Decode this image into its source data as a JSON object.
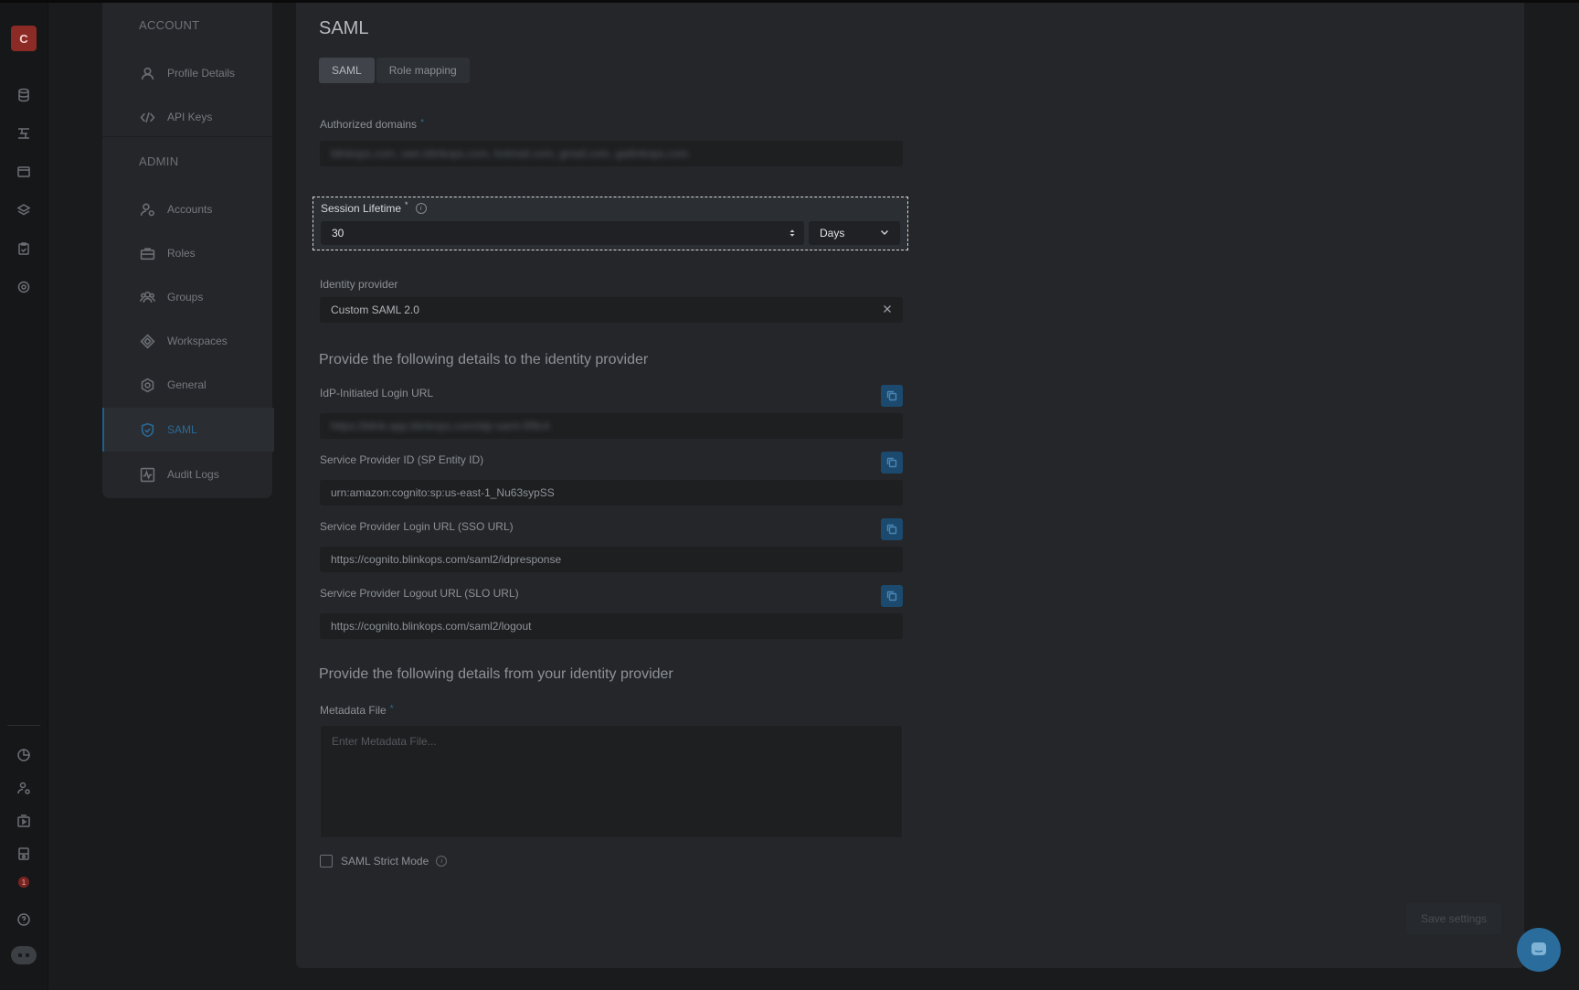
{
  "rail": {
    "avatar_letter": "C",
    "notification_count": "1"
  },
  "nav": {
    "account_heading": "ACCOUNT",
    "admin_heading": "ADMIN",
    "items": [
      {
        "label": "Profile Details",
        "icon": "user-icon"
      },
      {
        "label": "API Keys",
        "icon": "code-icon"
      },
      {
        "label": "Accounts",
        "icon": "user-gear-icon"
      },
      {
        "label": "Roles",
        "icon": "briefcase-icon"
      },
      {
        "label": "Groups",
        "icon": "users-icon"
      },
      {
        "label": "Workspaces",
        "icon": "diamond-icon"
      },
      {
        "label": "General",
        "icon": "gear-icon"
      },
      {
        "label": "SAML",
        "icon": "shield-check-icon"
      },
      {
        "label": "Audit Logs",
        "icon": "activity-icon"
      }
    ],
    "active_item": "SAML"
  },
  "page": {
    "title": "SAML",
    "tabs": [
      {
        "label": "SAML",
        "active": true
      },
      {
        "label": "Role mapping",
        "active": false
      }
    ],
    "authorized_domains": {
      "label": "Authorized domains",
      "value": "blinkops.com, own.blinkops.com, hotmail.com, gmail.com, gatlinkops.com"
    },
    "session_lifetime": {
      "label": "Session Lifetime",
      "value": "30",
      "unit": "Days"
    },
    "identity_provider": {
      "label": "Identity provider",
      "value": "Custom SAML 2.0"
    },
    "provide_to_heading": "Provide the following details to the identity provider",
    "idp_login_url": {
      "label": "IdP-Initiated Login URL",
      "value": "https://blink.app.blinkops.com/idp-saml-0f9c4"
    },
    "sp_entity_id": {
      "label": "Service Provider ID (SP Entity ID)",
      "value": "urn:amazon:cognito:sp:us-east-1_Nu63sypSS"
    },
    "sso_url": {
      "label": "Service Provider Login URL (SSO URL)",
      "value": "https://cognito.blinkops.com/saml2/idpresponse"
    },
    "slo_url": {
      "label": "Service Provider Logout URL (SLO URL)",
      "value": "https://cognito.blinkops.com/saml2/logout"
    },
    "provide_from_heading": "Provide the following details from your identity provider",
    "metadata_file": {
      "label": "Metadata File",
      "placeholder": "Enter Metadata File..."
    },
    "strict_mode": {
      "label": "SAML Strict Mode",
      "checked": false
    },
    "save_label": "Save settings"
  },
  "colors": {
    "accent": "#2a6a99",
    "required": "#2f6d9a",
    "avatar": "#8c2a26"
  }
}
